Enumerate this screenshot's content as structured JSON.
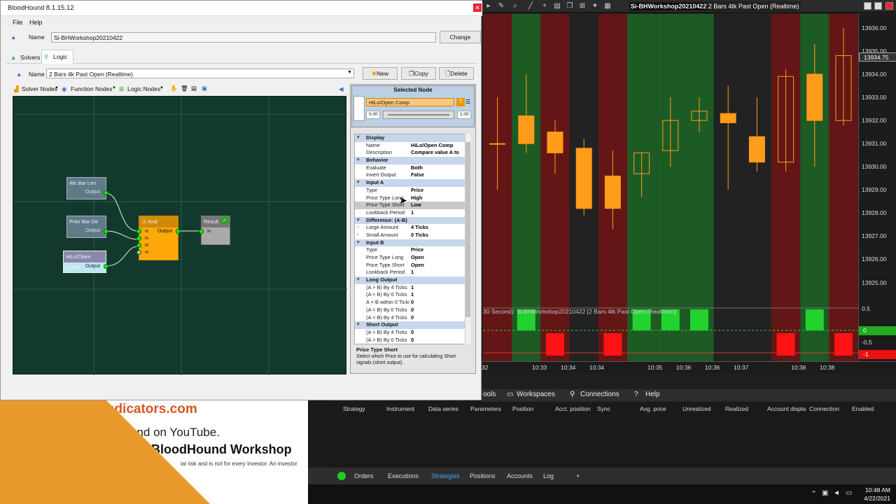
{
  "bloodhound": {
    "title": "BloodHound 8.1.15.12",
    "menu": [
      "File",
      "Help"
    ],
    "name_label": "Name",
    "solver_name": "Si-BHWorkshop20210422",
    "change_label": "Change",
    "tabs": [
      "Solvers",
      "Logic"
    ],
    "logic_name": "2 Bars 4k Past Open (Realtime)",
    "new_label": "New",
    "copy_label": "Copy",
    "delete_label": "Delete",
    "toolbar": [
      "Solver Nodes",
      "Function Nodes",
      "Logic Nodes"
    ],
    "nodes": {
      "n1": {
        "title": "4tk Bar Len",
        "out": "Output"
      },
      "n2": {
        "title": "Prior Bar Dir",
        "out": "Output"
      },
      "n3": {
        "title": "HiLo/Open Comp",
        "out": "Output"
      },
      "and": {
        "title": "And",
        "in": "In",
        "out": "Output"
      },
      "result": {
        "title": "Result",
        "in": "In"
      }
    },
    "selected": {
      "header": "Selected Node",
      "name": "HiLo/Open Comp",
      "min": "0.00",
      "max": "1.00"
    },
    "props": [
      {
        "cat": "Display"
      },
      {
        "k": "Name",
        "v": "HiLo/Open Comp"
      },
      {
        "k": "Description",
        "v": "Compare value A to"
      },
      {
        "cat": "Behavior"
      },
      {
        "k": "Evaluate",
        "v": "Both"
      },
      {
        "k": "Invert Output",
        "v": "False"
      },
      {
        "cat": "Input A"
      },
      {
        "k": "Type",
        "v": "Price"
      },
      {
        "k": "Price Type Long",
        "v": "High"
      },
      {
        "k": "Price Type Short",
        "v": "Low",
        "sel": true
      },
      {
        "k": "Lookback Period",
        "v": "1"
      },
      {
        "cat": "Difference: (A-B)"
      },
      {
        "k": "Large Amount",
        "v": "4 Ticks",
        "ch": true
      },
      {
        "k": "Small Amount",
        "v": "0 Ticks",
        "ch": true
      },
      {
        "cat": "Input B"
      },
      {
        "k": "Type",
        "v": "Price"
      },
      {
        "k": "Price Type Long",
        "v": "Open"
      },
      {
        "k": "Price Type Short",
        "v": "Open"
      },
      {
        "k": "Lookback Period",
        "v": "1"
      },
      {
        "cat": "Long Output"
      },
      {
        "k": "(A > B) By 4 Ticks",
        "v": "1"
      },
      {
        "k": "(A > B) By 0 Ticks",
        "v": "1"
      },
      {
        "k": "A = B within 0 Ticks",
        "v": "0"
      },
      {
        "k": "(A < B) By 0 Ticks",
        "v": "0"
      },
      {
        "k": "(A < B) By 4 Ticks",
        "v": "0"
      },
      {
        "cat": "Short Output"
      },
      {
        "k": "(A > B) By 4 Ticks",
        "v": "0"
      },
      {
        "k": "(A > B) By 0 Ticks",
        "v": "0"
      }
    ],
    "help_title": "Price Type Short",
    "help_text": "Select which Price to use for calculating Short signals (short output)."
  },
  "chart": {
    "title_left": "Si-BHWorkshop20210422",
    "title_right": "2 Bars 4tk Past Open (Realtime)",
    "indicator_label": "30 Second): Si-BHWorkshop20210422  [2 Bars 4tk Past Open (Realtime)]",
    "price_ticks": [
      "13936.00",
      "13935.00",
      "13934.00",
      "13933.00",
      "13932.00",
      "13931.00",
      "13930.00",
      "13929.00",
      "13928.00",
      "13927.00",
      "13926.00",
      "13925.00"
    ],
    "price_badge": "13934.75",
    "ind_ticks": [
      "0.5",
      "0",
      "-0.5",
      "-1"
    ],
    "time_ticks": [
      "32",
      "10:33",
      "10:34",
      "10:34",
      "10:35",
      "10:36",
      "10:36",
      "10:37",
      "10:38",
      "10:38"
    ]
  },
  "chart_data": {
    "type": "candlestick",
    "ylim": [
      13924.2,
      13936.6
    ],
    "candles": [
      {
        "o": 13931.0,
        "h": 13933.0,
        "l": 13929.0,
        "c": 13931.0,
        "dir": "up",
        "bg": "red"
      },
      {
        "o": 13932.2,
        "h": 13934.0,
        "l": 13930.6,
        "c": 13931.0,
        "dir": "down",
        "bg": "green"
      },
      {
        "o": 13931.5,
        "h": 13932.0,
        "l": 13929.7,
        "c": 13930.6,
        "dir": "down",
        "bg": "red"
      },
      {
        "o": 13930.8,
        "h": 13931.2,
        "l": 13927.9,
        "c": 13928.2,
        "dir": "down",
        "bg": "none"
      },
      {
        "o": 13929.6,
        "h": 13930.7,
        "l": 13927.3,
        "c": 13928.2,
        "dir": "down",
        "bg": "red"
      },
      {
        "o": 13929.7,
        "h": 13930.6,
        "l": 13928.7,
        "c": 13930.6,
        "dir": "up",
        "bg": "green"
      },
      {
        "o": 13930.7,
        "h": 13933.0,
        "l": 13930.0,
        "c": 13932.0,
        "dir": "up",
        "bg": "green"
      },
      {
        "o": 13932.0,
        "h": 13933.0,
        "l": 13931.5,
        "c": 13932.4,
        "dir": "up",
        "bg": "green"
      },
      {
        "o": 13932.3,
        "h": 13933.5,
        "l": 13929.0,
        "c": 13931.9,
        "dir": "down",
        "bg": "none"
      },
      {
        "o": 13931.3,
        "h": 13933.0,
        "l": 13929.8,
        "c": 13930.2,
        "dir": "down",
        "bg": "none"
      },
      {
        "o": 13930.2,
        "h": 13934.2,
        "l": 13929.8,
        "c": 13933.9,
        "dir": "up",
        "bg": "red"
      },
      {
        "o": 13932.0,
        "h": 13935.3,
        "l": 13930.0,
        "c": 13934.0,
        "dir": "down",
        "bg": "green"
      },
      {
        "o": 13932.0,
        "h": 13936.0,
        "l": 13931.8,
        "c": 13934.8,
        "dir": "up",
        "bg": "red"
      }
    ],
    "signals": [
      0,
      1,
      -1,
      0,
      -1,
      1,
      1,
      1,
      0,
      0,
      -1,
      1,
      -1
    ]
  },
  "control_center": {
    "menu": [
      "ools",
      "Workspaces",
      "Connections",
      "Help"
    ],
    "columns": [
      "Strategy",
      "Instrument",
      "Data series",
      "Parameters",
      "Position",
      "Acct. position",
      "Sync",
      "Avg. price",
      "Unrealized",
      "Realized",
      "Account displa",
      "Connection",
      "Enabled"
    ],
    "tabs": [
      "Orders",
      "Executions",
      "Strategies",
      "Positions",
      "Accounts",
      "Log",
      "+"
    ],
    "clock_time": "10:48 AM",
    "clock_date": "4/22/2021"
  },
  "promo": {
    "line1": "kIndicators.com",
    "line2": "und on YouTube.",
    "line3": "BloodHound Workshop",
    "line4": "ial risk and is not for every investor. An investor"
  }
}
